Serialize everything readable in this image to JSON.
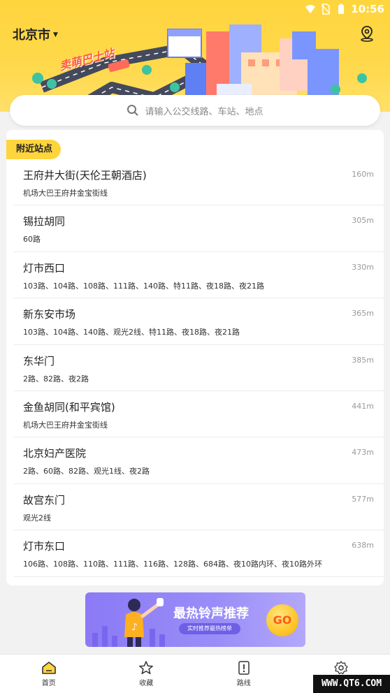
{
  "status_bar": {
    "time": "10:56",
    "battery_icon": "battery-icon",
    "wifi_icon": "wifi-icon"
  },
  "header": {
    "city": "北京市",
    "banner_text": "卖萌巴士站",
    "search_placeholder": "请输入公交线路、车站、地点"
  },
  "nearby": {
    "section_title": "附近站点",
    "stops": [
      {
        "name": "王府井大街(天伦王朝酒店)",
        "lines": "机场大巴王府井金宝街线",
        "distance": "160m"
      },
      {
        "name": "锡拉胡同",
        "lines": "60路",
        "distance": "305m"
      },
      {
        "name": "灯市西口",
        "lines": "103路、104路、108路、111路、140路、特11路、夜18路、夜21路",
        "distance": "330m"
      },
      {
        "name": "新东安市场",
        "lines": "103路、104路、140路、观光2线、特11路、夜18路、夜21路",
        "distance": "365m"
      },
      {
        "name": "东华门",
        "lines": "2路、82路、夜2路",
        "distance": "385m"
      },
      {
        "name": "金鱼胡同(和平宾馆)",
        "lines": "机场大巴王府井金宝街线",
        "distance": "441m"
      },
      {
        "name": "北京妇产医院",
        "lines": "2路、60路、82路、观光1线、夜2路",
        "distance": "473m"
      },
      {
        "name": "故宫东门",
        "lines": "观光2线",
        "distance": "577m"
      },
      {
        "name": "灯市东口",
        "lines": "106路、108路、110路、111路、116路、128路、684路、夜10路内环、夜10路外环",
        "distance": "638m"
      }
    ]
  },
  "ad": {
    "title": "最热铃声推荐",
    "subtitle": "实时推荐最热榜单",
    "go": "GO"
  },
  "bottom_nav": [
    {
      "label": "首页",
      "icon": "home-icon",
      "active": true
    },
    {
      "label": "收藏",
      "icon": "star-icon",
      "active": false
    },
    {
      "label": "路线",
      "icon": "route-icon",
      "active": false
    },
    {
      "label": "设置",
      "icon": "settings-icon",
      "active": false
    }
  ],
  "watermark": "WWW.QT6.COM",
  "colors": {
    "accent": "#ffd53d",
    "brand_orange": "#ff5a3c",
    "ad_purple": "#8b7af5"
  }
}
